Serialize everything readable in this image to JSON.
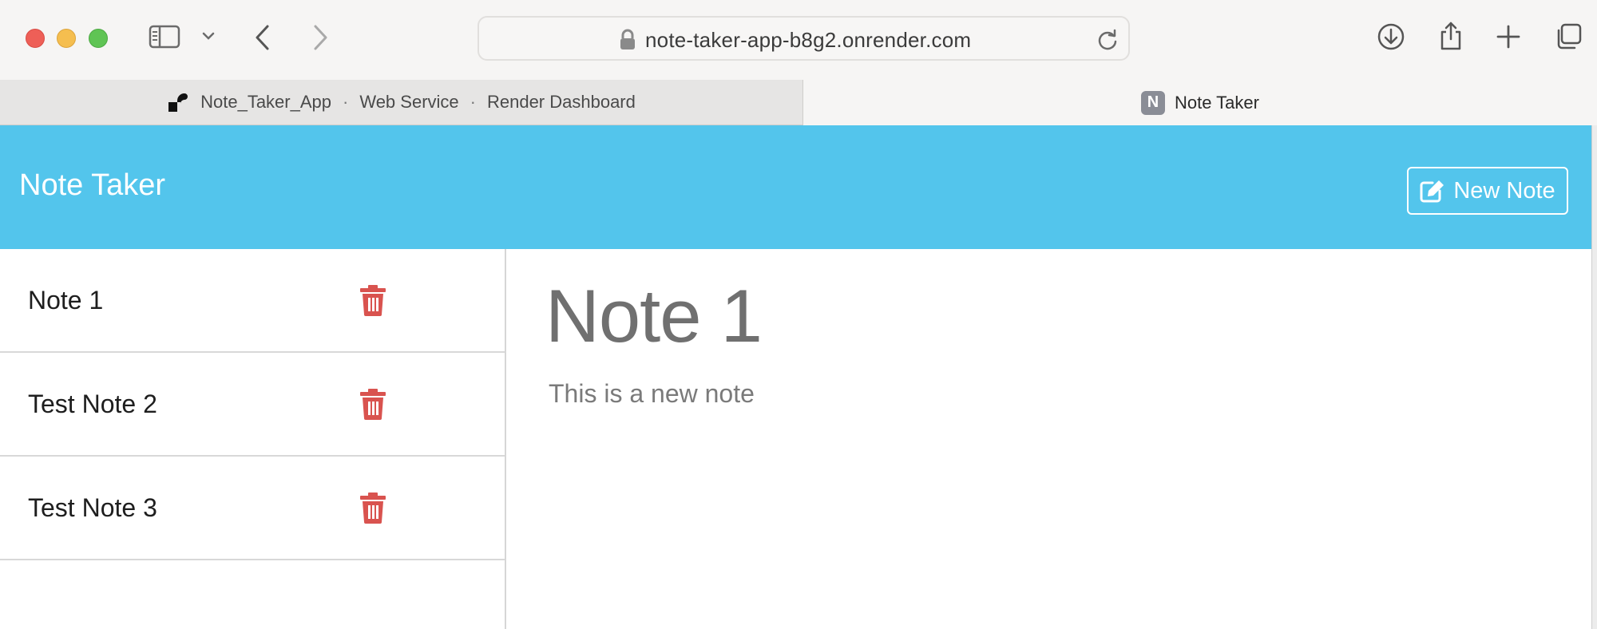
{
  "browser": {
    "url": "note-taker-app-b8g2.onrender.com",
    "tabs": [
      {
        "parts": [
          "Note_Taker_App",
          "Web Service",
          "Render Dashboard"
        ],
        "separator": "·",
        "active": false
      },
      {
        "label": "Note Taker",
        "favicon_letter": "N",
        "active": true
      }
    ],
    "icons": [
      "sidebar-icon",
      "chevron-down-icon",
      "back-icon",
      "forward-icon",
      "lock-icon",
      "reload-icon",
      "download-icon",
      "share-icon",
      "plus-icon",
      "tabs-overview-icon"
    ]
  },
  "app": {
    "brand": "Note Taker",
    "new_note_label": "New Note",
    "colors": {
      "navbar": "#53c5ec",
      "trash": "#d9534f"
    },
    "notes": [
      {
        "title": "Note 1"
      },
      {
        "title": "Test Note 2"
      },
      {
        "title": "Test Note 3"
      }
    ],
    "active_note": {
      "title": "Note 1",
      "text": "This is a new note"
    }
  }
}
